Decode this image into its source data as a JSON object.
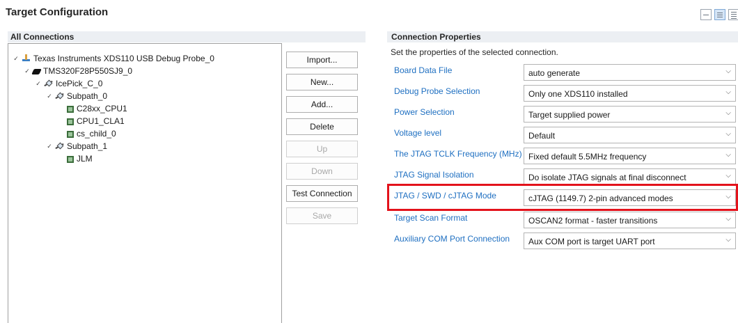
{
  "title": "Target Configuration",
  "view_icons": [
    "collapse-icon",
    "detail-view-icon",
    "list-view-icon"
  ],
  "left": {
    "header": "All Connections",
    "tree": [
      {
        "label": "Texas Instruments XDS110 USB Debug Probe_0",
        "icon": "debug-probe-icon",
        "level": 0,
        "expanded": true
      },
      {
        "label": "TMS320F28P550SJ9_0",
        "icon": "chip-icon",
        "level": 1,
        "expanded": true
      },
      {
        "label": "IcePick_C_0",
        "icon": "router-icon",
        "level": 2,
        "expanded": true
      },
      {
        "label": "Subpath_0",
        "icon": "router-icon",
        "level": 3,
        "expanded": true
      },
      {
        "label": "C28xx_CPU1",
        "icon": "core-icon",
        "level": 4
      },
      {
        "label": "CPU1_CLA1",
        "icon": "core-icon",
        "level": 4
      },
      {
        "label": "cs_child_0",
        "icon": "core-icon",
        "level": 4
      },
      {
        "label": "Subpath_1",
        "icon": "router-icon",
        "level": 3,
        "expanded": true
      },
      {
        "label": "JLM",
        "icon": "core-icon",
        "level": 4
      }
    ],
    "buttons": {
      "import": "Import...",
      "new": "New...",
      "add": "Add...",
      "delete": "Delete",
      "up": "Up",
      "down": "Down",
      "test": "Test Connection",
      "save": "Save"
    }
  },
  "right": {
    "header": "Connection Properties",
    "description": "Set the properties of the selected connection.",
    "properties": [
      {
        "label": "Board Data File",
        "value": "auto generate"
      },
      {
        "label": "Debug Probe Selection",
        "value": "Only one XDS110 installed"
      },
      {
        "label": "Power Selection",
        "value": "Target supplied power"
      },
      {
        "label": "Voltage level",
        "value": "Default"
      },
      {
        "label": "The JTAG TCLK Frequency (MHz)",
        "value": "Fixed default 5.5MHz frequency"
      },
      {
        "label": "JTAG Signal Isolation",
        "value": "Do isolate JTAG signals at final disconnect"
      },
      {
        "label": "JTAG / SWD / cJTAG Mode",
        "value": "cJTAG (1149.7) 2-pin advanced modes",
        "highlighted": true
      },
      {
        "label": "Target Scan Format",
        "value": "OSCAN2 format - faster transitions"
      },
      {
        "label": "Auxiliary COM Port Connection",
        "value": "Aux COM port is target UART port"
      }
    ]
  },
  "colors": {
    "link_label": "#1e6fc1",
    "highlight_border": "#e3121b",
    "section_header_bg": "#eceff3"
  }
}
